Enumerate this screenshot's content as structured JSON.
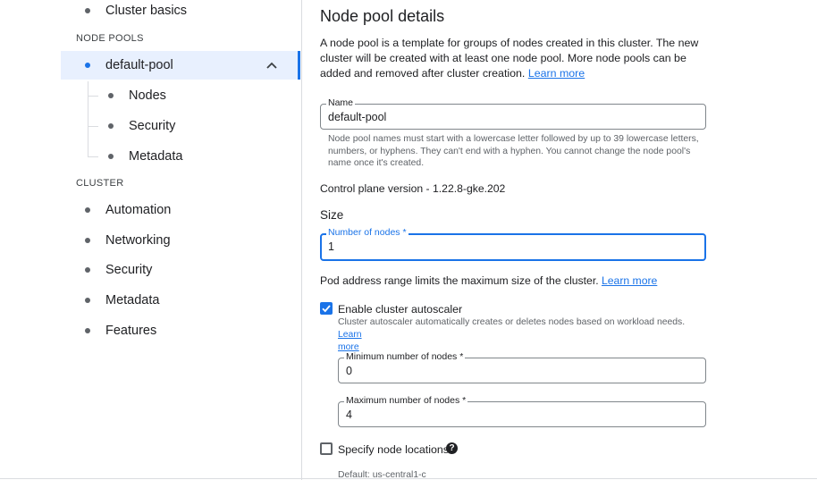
{
  "sidebar": {
    "cluster_basics": "Cluster basics",
    "node_pools_heading": "NODE POOLS",
    "default_pool": "default-pool",
    "pool_children": [
      "Nodes",
      "Security",
      "Metadata"
    ],
    "cluster_heading": "CLUSTER",
    "cluster_items": [
      "Automation",
      "Networking",
      "Security",
      "Metadata",
      "Features"
    ]
  },
  "main": {
    "title": "Node pool details",
    "intro": "A node pool is a template for groups of nodes created in this cluster. The new cluster will be created with at least one node pool. More node pools can be added and removed after cluster creation.",
    "intro_link": "Learn more",
    "name_label": "Name",
    "name_value": "default-pool",
    "name_hint": "Node pool names must start with a lowercase letter followed by up to 39 lowercase letters, numbers, or hyphens. They can't end with a hyphen. You cannot change the node pool's name once it's created.",
    "control_plane": "Control plane version - 1.22.8-gke.202",
    "size_heading": "Size",
    "num_nodes_label": "Number of nodes *",
    "num_nodes_value": "1",
    "pod_range_text": "Pod address range limits the maximum size of the cluster.",
    "pod_range_link": "Learn more",
    "autoscaler_label": "Enable cluster autoscaler",
    "autoscaler_checked": true,
    "autoscaler_hint": "Cluster autoscaler automatically creates or deletes nodes based on workload needs.",
    "autoscaler_link_1": "Learn",
    "autoscaler_link_2": "more",
    "min_nodes_label": "Minimum number of nodes *",
    "min_nodes_value": "0",
    "max_nodes_label": "Maximum number of nodes *",
    "max_nodes_value": "4",
    "locations_label": "Specify node locations",
    "locations_checked": false,
    "help_glyph": "?",
    "default_location": "Default: us-central1-c"
  },
  "colors": {
    "accent": "#1a73e8",
    "active_bg": "#e8f0fe",
    "border": "#80868b"
  }
}
